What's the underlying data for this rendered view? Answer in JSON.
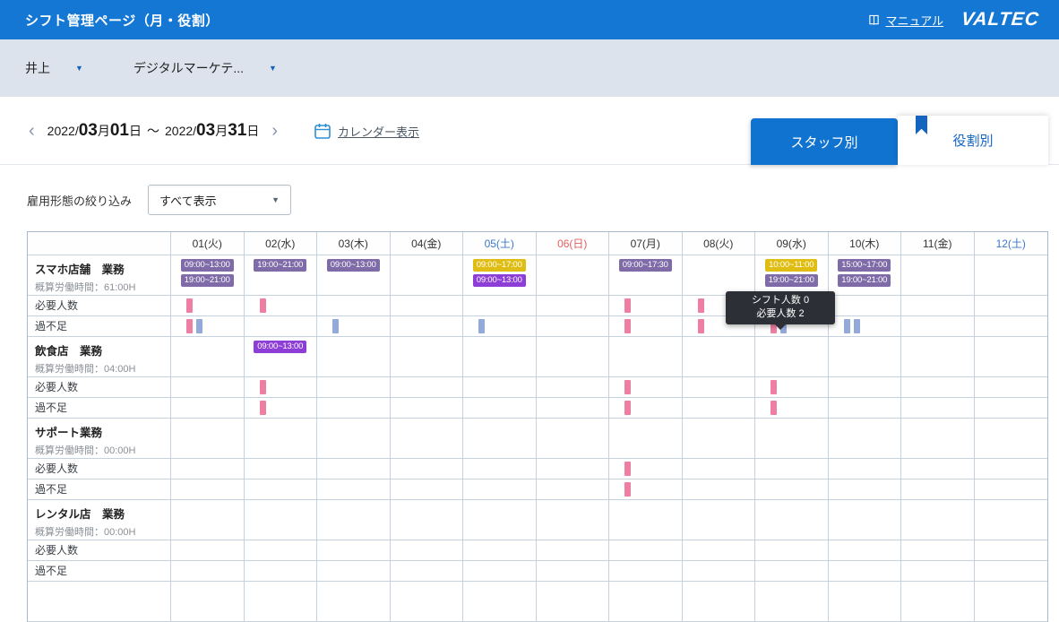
{
  "header": {
    "title": "シフト管理ページ（月・役割）",
    "manual_label": "マニュアル",
    "logo": "VALTEC"
  },
  "icons": {
    "caret_down": "▼",
    "chevron_left": "‹",
    "chevron_right": "›"
  },
  "subbar": {
    "staff_filter": "井上",
    "dept_filter": "デジタルマーケテ..."
  },
  "date_nav": {
    "start_year": "2022/",
    "start_month": "03",
    "month_unit": "月",
    "start_day": "01",
    "day_unit": "日",
    "separator": "～",
    "end_year": "2022/",
    "end_month": "03",
    "end_day": "31",
    "calendar_label": "カレンダー表示"
  },
  "tabs": {
    "staff": "スタッフ別",
    "role": "役割別"
  },
  "filter": {
    "label": "雇用形態の絞り込み",
    "value": "すべて表示"
  },
  "tooltip": {
    "line1": "シフト人数 0",
    "line2": "必要人数 2"
  },
  "palette": {
    "purple": "#7e6ba8",
    "violet": "#8d3ed6",
    "yellow": "#e0bd12",
    "pink": "#ee7fa3",
    "blue": "#93a9da"
  },
  "table": {
    "required_label": "必要人数",
    "balance_label": "過不足",
    "columns": [
      {
        "label": "01(火)",
        "type": "wd"
      },
      {
        "label": "02(水)",
        "type": "wd"
      },
      {
        "label": "03(木)",
        "type": "wd"
      },
      {
        "label": "04(金)",
        "type": "wd"
      },
      {
        "label": "05(土)",
        "type": "sat"
      },
      {
        "label": "06(日)",
        "type": "sun"
      },
      {
        "label": "07(月)",
        "type": "wd"
      },
      {
        "label": "08(火)",
        "type": "wd"
      },
      {
        "label": "09(水)",
        "type": "wd"
      },
      {
        "label": "10(木)",
        "type": "wd"
      },
      {
        "label": "11(金)",
        "type": "wd"
      },
      {
        "label": "12(土)",
        "type": "sat"
      }
    ],
    "groups": [
      {
        "name": "スマホ店舗　業務",
        "hours": "概算労働時間：61:00H",
        "shifts": {
          "0": [
            {
              "t": "09:00~13:00",
              "c": "purple"
            },
            {
              "t": "19:00~21:00",
              "c": "purple"
            }
          ],
          "1": [
            {
              "t": "19:00~21:00",
              "c": "purple"
            }
          ],
          "2": [
            {
              "t": "09:00~13:00",
              "c": "purple"
            }
          ],
          "4": [
            {
              "t": "09:00~17:00",
              "c": "yellow"
            },
            {
              "t": "09:00~13:00",
              "c": "violet"
            }
          ],
          "6": [
            {
              "t": "09:00~17:30",
              "c": "purple"
            }
          ],
          "8": [
            {
              "t": "10:00~11:00",
              "c": "yellow"
            },
            {
              "t": "19:00~21:00",
              "c": "purple"
            }
          ],
          "9": [
            {
              "t": "15:00~17:00",
              "c": "purple"
            },
            {
              "t": "19:00~21:00",
              "c": "purple"
            }
          ]
        },
        "required": {
          "0": [
            "pink"
          ],
          "1": [
            "pink"
          ],
          "6": [
            "pink"
          ],
          "7": [
            "pink"
          ],
          "8": [
            "pink"
          ]
        },
        "balance": {
          "0": [
            "pink",
            "blue"
          ],
          "2": [
            "blue"
          ],
          "4": [
            "blue"
          ],
          "6": [
            "pink"
          ],
          "7": [
            "pink"
          ],
          "8": [
            "pink",
            "blue"
          ],
          "9": [
            "blue",
            "blue"
          ]
        }
      },
      {
        "name": "飲食店　業務",
        "hours": "概算労働時間：04:00H",
        "shifts": {
          "1": [
            {
              "t": "09:00~13:00",
              "c": "violet"
            }
          ]
        },
        "required": {
          "1": [
            "pink"
          ],
          "6": [
            "pink"
          ],
          "8": [
            "pink"
          ]
        },
        "balance": {
          "1": [
            "pink"
          ],
          "6": [
            "pink"
          ],
          "8": [
            "pink"
          ]
        }
      },
      {
        "name": "サポート業務",
        "hours": "概算労働時間：00:00H",
        "shifts": {},
        "required": {
          "6": [
            "pink"
          ]
        },
        "balance": {
          "6": [
            "pink"
          ]
        }
      },
      {
        "name": "レンタル店　業務",
        "hours": "概算労働時間：00:00H",
        "shifts": {},
        "required": {},
        "balance": {}
      },
      {
        "name": "",
        "hours": "",
        "shifts": {},
        "required": {},
        "balance": {}
      }
    ]
  }
}
